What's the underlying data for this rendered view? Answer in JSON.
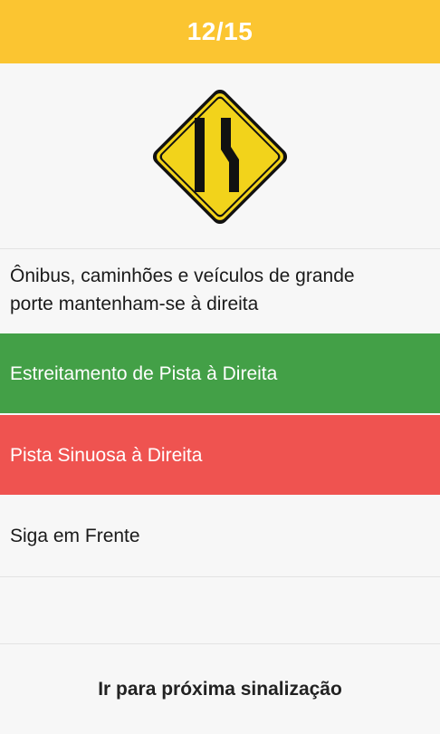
{
  "header": {
    "counter": "12/15",
    "background_color": "#fbc531"
  },
  "sign": {
    "icon": "lane-narrows-right-sign-icon",
    "fill_color": "#f2d31b",
    "border_color": "#111111"
  },
  "options": [
    {
      "label": "Ônibus, caminhões e veículos de grande porte mantenham-se à direita",
      "state": "neutral"
    },
    {
      "label": "Estreitamento de Pista à Direita",
      "state": "correct",
      "color": "#43a047"
    },
    {
      "label": "Pista Sinuosa à Direita",
      "state": "wrong",
      "color": "#ef5350"
    },
    {
      "label": "Siga em Frente",
      "state": "neutral"
    }
  ],
  "footer": {
    "next_label": "Ir para próxima sinalização"
  }
}
